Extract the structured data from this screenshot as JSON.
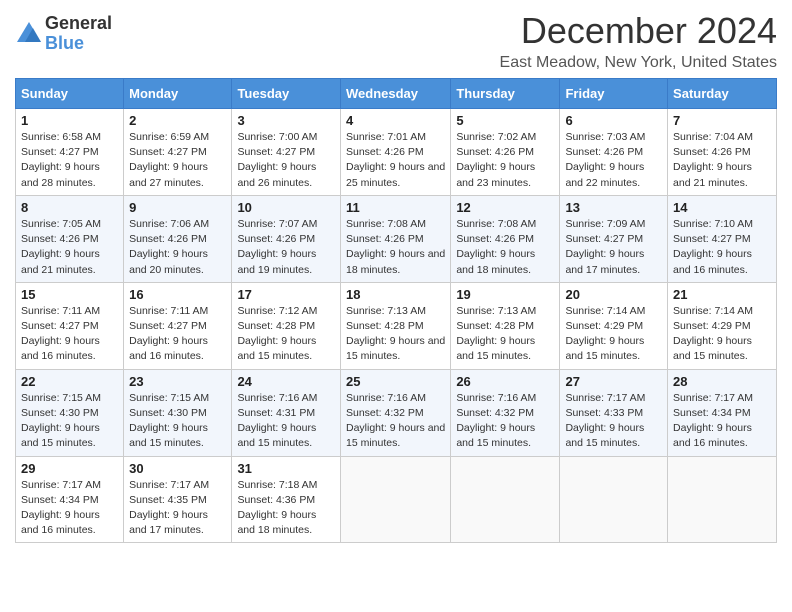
{
  "header": {
    "logo_general": "General",
    "logo_blue": "Blue",
    "month_title": "December 2024",
    "location": "East Meadow, New York, United States"
  },
  "weekdays": [
    "Sunday",
    "Monday",
    "Tuesday",
    "Wednesday",
    "Thursday",
    "Friday",
    "Saturday"
  ],
  "weeks": [
    [
      {
        "day": "1",
        "sunrise": "6:58 AM",
        "sunset": "4:27 PM",
        "daylight": "9 hours and 28 minutes."
      },
      {
        "day": "2",
        "sunrise": "6:59 AM",
        "sunset": "4:27 PM",
        "daylight": "9 hours and 27 minutes."
      },
      {
        "day": "3",
        "sunrise": "7:00 AM",
        "sunset": "4:27 PM",
        "daylight": "9 hours and 26 minutes."
      },
      {
        "day": "4",
        "sunrise": "7:01 AM",
        "sunset": "4:26 PM",
        "daylight": "9 hours and 25 minutes."
      },
      {
        "day": "5",
        "sunrise": "7:02 AM",
        "sunset": "4:26 PM",
        "daylight": "9 hours and 23 minutes."
      },
      {
        "day": "6",
        "sunrise": "7:03 AM",
        "sunset": "4:26 PM",
        "daylight": "9 hours and 22 minutes."
      },
      {
        "day": "7",
        "sunrise": "7:04 AM",
        "sunset": "4:26 PM",
        "daylight": "9 hours and 21 minutes."
      }
    ],
    [
      {
        "day": "8",
        "sunrise": "7:05 AM",
        "sunset": "4:26 PM",
        "daylight": "9 hours and 21 minutes."
      },
      {
        "day": "9",
        "sunrise": "7:06 AM",
        "sunset": "4:26 PM",
        "daylight": "9 hours and 20 minutes."
      },
      {
        "day": "10",
        "sunrise": "7:07 AM",
        "sunset": "4:26 PM",
        "daylight": "9 hours and 19 minutes."
      },
      {
        "day": "11",
        "sunrise": "7:08 AM",
        "sunset": "4:26 PM",
        "daylight": "9 hours and 18 minutes."
      },
      {
        "day": "12",
        "sunrise": "7:08 AM",
        "sunset": "4:26 PM",
        "daylight": "9 hours and 18 minutes."
      },
      {
        "day": "13",
        "sunrise": "7:09 AM",
        "sunset": "4:27 PM",
        "daylight": "9 hours and 17 minutes."
      },
      {
        "day": "14",
        "sunrise": "7:10 AM",
        "sunset": "4:27 PM",
        "daylight": "9 hours and 16 minutes."
      }
    ],
    [
      {
        "day": "15",
        "sunrise": "7:11 AM",
        "sunset": "4:27 PM",
        "daylight": "9 hours and 16 minutes."
      },
      {
        "day": "16",
        "sunrise": "7:11 AM",
        "sunset": "4:27 PM",
        "daylight": "9 hours and 16 minutes."
      },
      {
        "day": "17",
        "sunrise": "7:12 AM",
        "sunset": "4:28 PM",
        "daylight": "9 hours and 15 minutes."
      },
      {
        "day": "18",
        "sunrise": "7:13 AM",
        "sunset": "4:28 PM",
        "daylight": "9 hours and 15 minutes."
      },
      {
        "day": "19",
        "sunrise": "7:13 AM",
        "sunset": "4:28 PM",
        "daylight": "9 hours and 15 minutes."
      },
      {
        "day": "20",
        "sunrise": "7:14 AM",
        "sunset": "4:29 PM",
        "daylight": "9 hours and 15 minutes."
      },
      {
        "day": "21",
        "sunrise": "7:14 AM",
        "sunset": "4:29 PM",
        "daylight": "9 hours and 15 minutes."
      }
    ],
    [
      {
        "day": "22",
        "sunrise": "7:15 AM",
        "sunset": "4:30 PM",
        "daylight": "9 hours and 15 minutes."
      },
      {
        "day": "23",
        "sunrise": "7:15 AM",
        "sunset": "4:30 PM",
        "daylight": "9 hours and 15 minutes."
      },
      {
        "day": "24",
        "sunrise": "7:16 AM",
        "sunset": "4:31 PM",
        "daylight": "9 hours and 15 minutes."
      },
      {
        "day": "25",
        "sunrise": "7:16 AM",
        "sunset": "4:32 PM",
        "daylight": "9 hours and 15 minutes."
      },
      {
        "day": "26",
        "sunrise": "7:16 AM",
        "sunset": "4:32 PM",
        "daylight": "9 hours and 15 minutes."
      },
      {
        "day": "27",
        "sunrise": "7:17 AM",
        "sunset": "4:33 PM",
        "daylight": "9 hours and 15 minutes."
      },
      {
        "day": "28",
        "sunrise": "7:17 AM",
        "sunset": "4:34 PM",
        "daylight": "9 hours and 16 minutes."
      }
    ],
    [
      {
        "day": "29",
        "sunrise": "7:17 AM",
        "sunset": "4:34 PM",
        "daylight": "9 hours and 16 minutes."
      },
      {
        "day": "30",
        "sunrise": "7:17 AM",
        "sunset": "4:35 PM",
        "daylight": "9 hours and 17 minutes."
      },
      {
        "day": "31",
        "sunrise": "7:18 AM",
        "sunset": "4:36 PM",
        "daylight": "9 hours and 18 minutes."
      },
      null,
      null,
      null,
      null
    ]
  ],
  "labels": {
    "sunrise": "Sunrise:",
    "sunset": "Sunset:",
    "daylight": "Daylight:"
  }
}
